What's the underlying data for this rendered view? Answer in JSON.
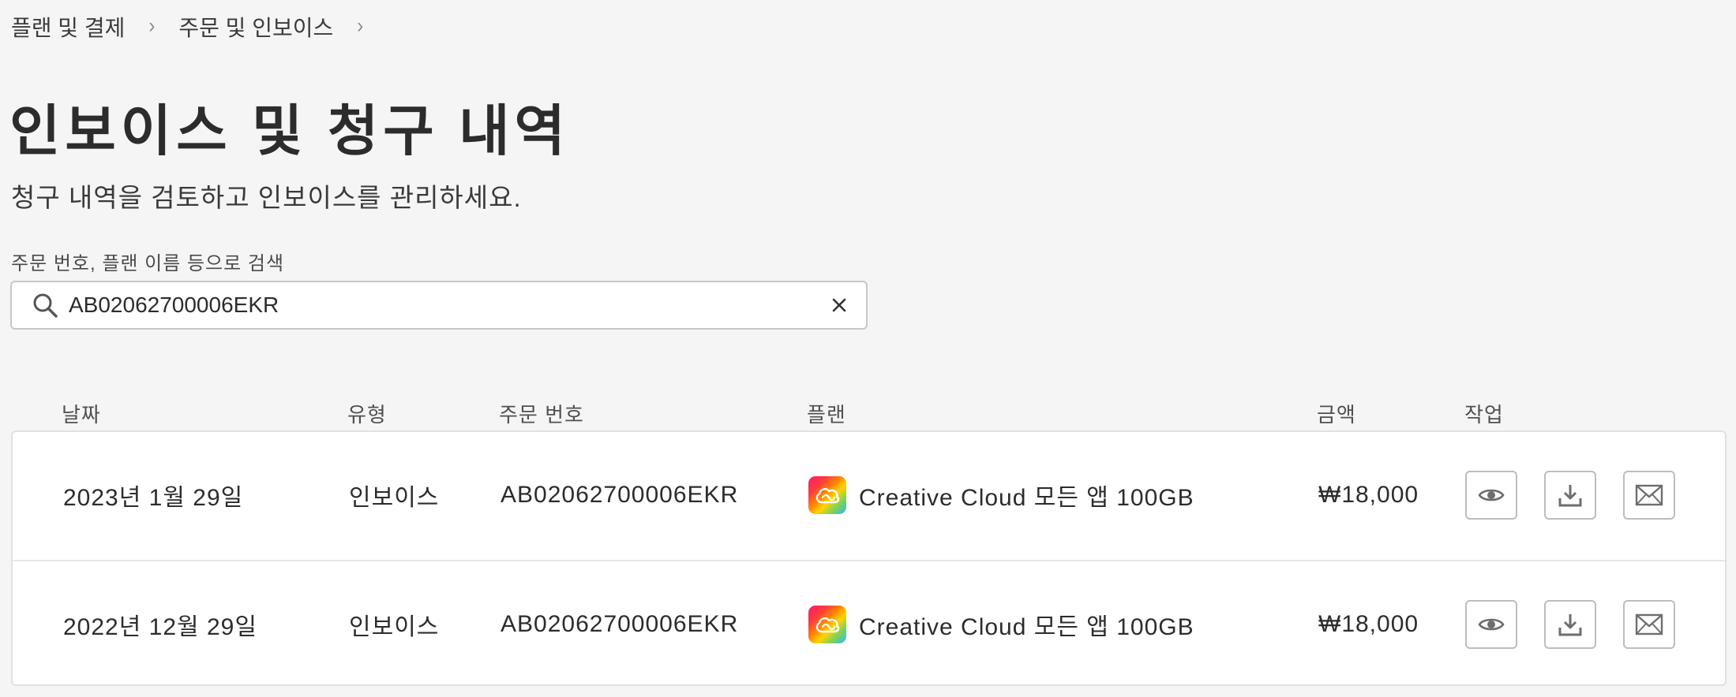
{
  "breadcrumb": {
    "items": [
      "플랜 및 결제",
      "주문 및 인보이스"
    ],
    "separator": "›"
  },
  "page": {
    "title": "인보이스 및 청구 내역",
    "subtitle": "청구 내역을 검토하고 인보이스를 관리하세요."
  },
  "search": {
    "label": "주문 번호, 플랜 이름 등으로 검색",
    "value": "AB02062700006EKR",
    "icon": "search-icon",
    "clear_icon": "close-icon"
  },
  "table": {
    "headers": {
      "date": "날짜",
      "type": "유형",
      "order": "주문 번호",
      "plan": "플랜",
      "amount": "금액",
      "actions": "작업"
    },
    "rows": [
      {
        "date": "2023년 1월 29일",
        "type": "인보이스",
        "order": "AB02062700006EKR",
        "plan": "Creative Cloud 모든 앱 100GB",
        "amount": "₩18,000"
      },
      {
        "date": "2022년 12월 29일",
        "type": "인보이스",
        "order": "AB02062700006EKR",
        "plan": "Creative Cloud 모든 앱 100GB",
        "amount": "₩18,000"
      }
    ],
    "action_icons": [
      "eye-icon",
      "download-icon",
      "mail-icon"
    ]
  },
  "colors": {
    "background": "#f5f5f5",
    "text": "#2c2c2c",
    "border": "#c8c8c8",
    "icon": "#6e6e6e"
  }
}
